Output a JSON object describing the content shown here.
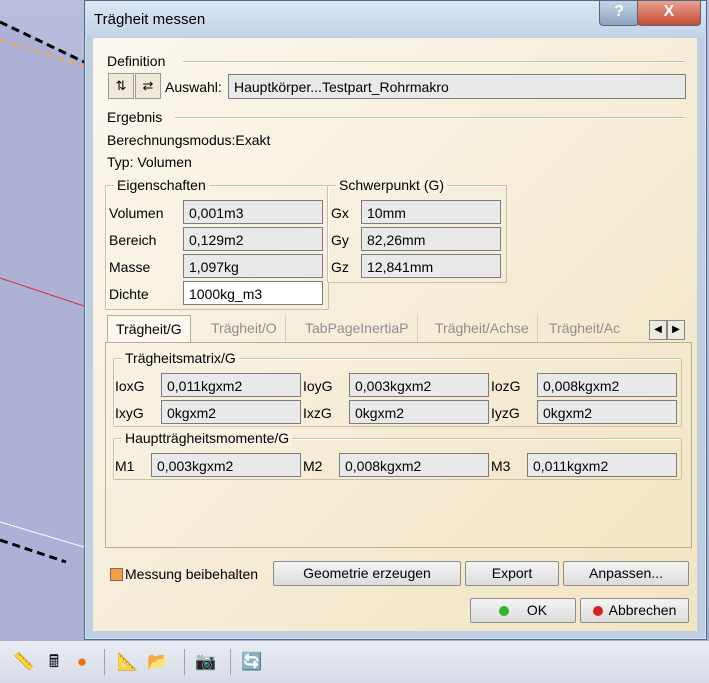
{
  "window": {
    "title": "Trägheit messen",
    "help_label": "?",
    "close_label": "X"
  },
  "definition": {
    "heading": "Definition",
    "selection_label": "Auswahl:",
    "selection_value": "Hauptkörper...Testpart_Rohrmakro"
  },
  "result": {
    "heading": "Ergebnis",
    "mode": "Berechnungsmodus:Exakt",
    "type": "Typ: Volumen"
  },
  "properties": {
    "title": "Eigenschaften",
    "rows": [
      {
        "label": "Volumen",
        "value": "0,001m3"
      },
      {
        "label": "Bereich",
        "value": "0,129m2"
      },
      {
        "label": "Masse",
        "value": "1,097kg"
      },
      {
        "label": "Dichte",
        "value": "1000kg_m3"
      }
    ]
  },
  "centroid": {
    "title": "Schwerpunkt (G)",
    "rows": [
      {
        "label": "Gx",
        "value": "10mm"
      },
      {
        "label": "Gy",
        "value": "82,26mm"
      },
      {
        "label": "Gz",
        "value": "12,841mm"
      }
    ]
  },
  "tabs": [
    "Trägheit/G",
    "Trägheit/O",
    "TabPageInertiaP",
    "Trägheit/Achse",
    "Trägheit/Ac"
  ],
  "active_tab": "Trägheit/G",
  "inertia_matrix": {
    "title": "Trägheitsmatrix/G",
    "cells": [
      {
        "label": "IoxG",
        "value": "0,011kgxm2"
      },
      {
        "label": "IoyG",
        "value": "0,003kgxm2"
      },
      {
        "label": "IozG",
        "value": "0,008kgxm2"
      },
      {
        "label": "IxyG",
        "value": "0kgxm2"
      },
      {
        "label": "IxzG",
        "value": "0kgxm2"
      },
      {
        "label": "IyzG",
        "value": "0kgxm2"
      }
    ]
  },
  "principal_moments": {
    "title": "Hauptträgheitsmomente/G",
    "cells": [
      {
        "label": "M1",
        "value": "0,003kgxm2"
      },
      {
        "label": "M2",
        "value": "0,008kgxm2"
      },
      {
        "label": "M3",
        "value": "0,011kgxm2"
      }
    ]
  },
  "keep_measure_label": "Messung beibehalten",
  "buttons": {
    "geometry": "Geometrie erzeugen",
    "export": "Export",
    "customize": "Anpassen...",
    "ok": "OK",
    "cancel": "Abbrechen"
  },
  "colors": {
    "ok_dot": "#2db52d",
    "cancel_dot": "#d42020",
    "checkbox": "#f0a040"
  }
}
